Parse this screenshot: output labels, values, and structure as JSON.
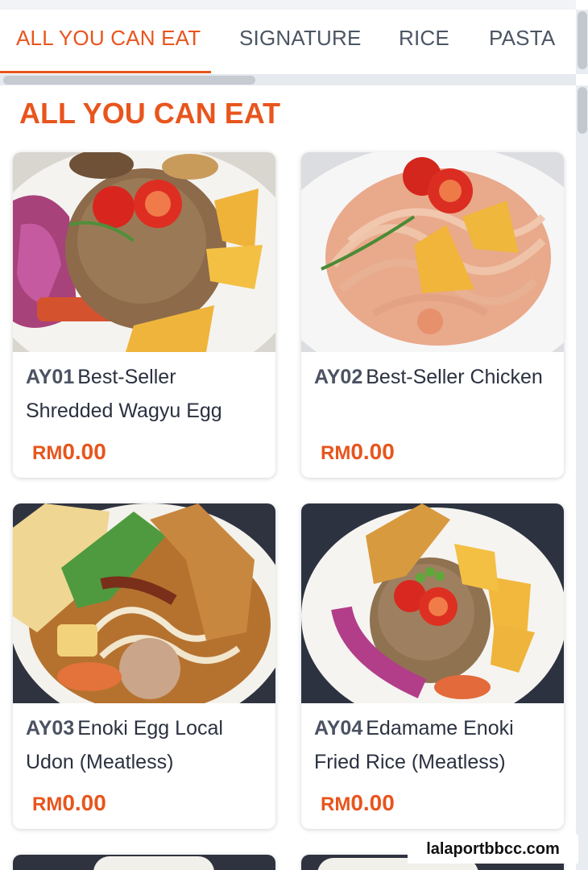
{
  "tabs": [
    {
      "label": "ALL YOU CAN EAT",
      "active": true
    },
    {
      "label": "SIGNATURE",
      "active": false
    },
    {
      "label": "RICE",
      "active": false
    },
    {
      "label": "PASTA",
      "active": false
    }
  ],
  "section": {
    "title": "ALL YOU CAN EAT"
  },
  "items": [
    {
      "code": "AY01",
      "name": "Best-Seller Shredded Wagyu Egg",
      "currency": "RM",
      "price": "0.00",
      "image": "fried-rice-dish-photo"
    },
    {
      "code": "AY02",
      "name": "Best-Seller Chicken",
      "currency": "RM",
      "price": "0.00",
      "image": "pasta-dish-photo"
    },
    {
      "code": "AY03",
      "name": "Enoki Egg Local Udon (Meatless)",
      "currency": "RM",
      "price": "0.00",
      "image": "udon-soup-photo"
    },
    {
      "code": "AY04",
      "name": "Edamame Enoki Fried Rice (Meatless)",
      "currency": "RM",
      "price": "0.00",
      "image": "fried-rice-dish-photo"
    }
  ],
  "watermark": "lalaportbbcc.com",
  "colors": {
    "accent": "#e8551d",
    "text": "#2b3140",
    "scrollbar": "#c3c8cf"
  }
}
